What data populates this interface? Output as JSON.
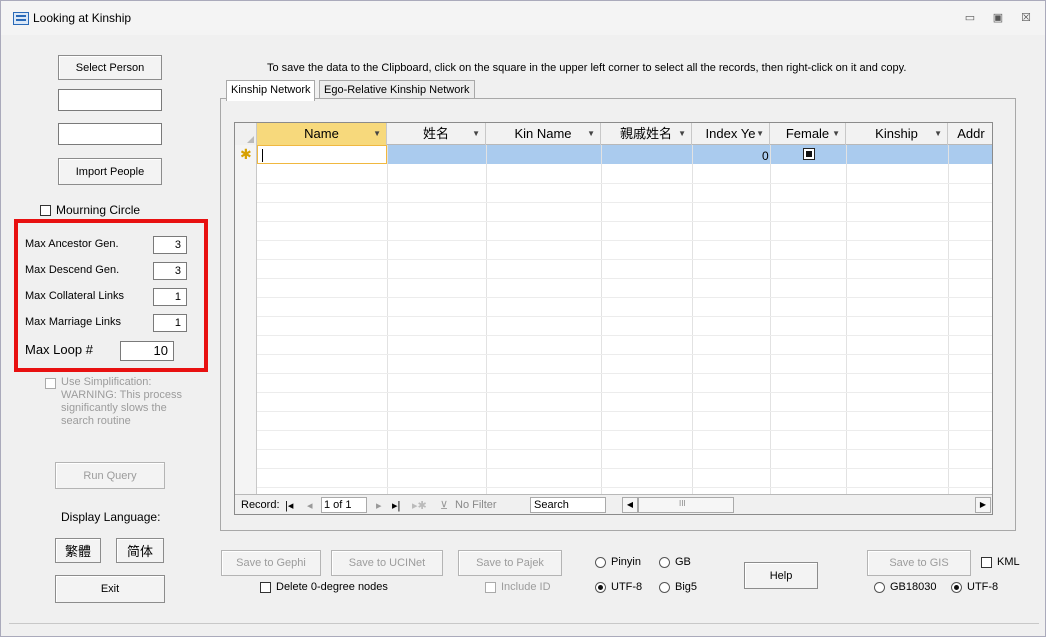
{
  "window": {
    "title": "Looking at Kinship",
    "minimize": "▭",
    "maximize": "▣",
    "close": "☒"
  },
  "left": {
    "select_person": "Select Person",
    "import_people": "Import People",
    "mourning_circle": "Mourning Circle",
    "params": [
      {
        "label": "Max Ancestor Gen.",
        "value": "3"
      },
      {
        "label": "Max Descend Gen.",
        "value": "3"
      },
      {
        "label": "Max Collateral Links",
        "value": "1"
      },
      {
        "label": "Max Marriage Links",
        "value": "1"
      }
    ],
    "max_loop_label": "Max Loop #",
    "max_loop_value": "10",
    "use_simplification": "Use Simplification:",
    "warning_line1": "WARNING: This process",
    "warning_line2": "significantly slows the",
    "warning_line3": "search routine",
    "run_query": "Run Query",
    "display_language": "Display Language:",
    "lang_traditional": "繁體",
    "lang_simplified": "简体",
    "exit": "Exit"
  },
  "main": {
    "instruction": "To save the data to the Clipboard, click on the square in the upper left corner to select all the records, then right-click on it and copy.",
    "tabs": [
      "Kinship Network",
      "Ego-Relative Kinship Network"
    ],
    "grid": {
      "columns": [
        "Name",
        "姓名",
        "Kin Name",
        "親戚姓名",
        "Index Ye",
        "Female",
        "Kinship",
        "Addr"
      ],
      "new_row_index_year": "0",
      "new_row_marker": "✱"
    },
    "nav": {
      "record_label": "Record:",
      "first": "|◂",
      "prev": "◂",
      "current": "1 of 1",
      "next": "▸",
      "last": "▸|",
      "new": "▸✱",
      "filter": "No Filter",
      "search": "Search",
      "scroll_left": "◀",
      "scroll_thumb": "III",
      "scroll_right": "▶"
    }
  },
  "bottom": {
    "save_gephi": "Save to Gephi",
    "save_ucinet": "Save to UCINet",
    "save_pajek": "Save to Pajek",
    "delete_zero": "Delete 0-degree nodes",
    "include_id": "Include ID",
    "pinyin": "Pinyin",
    "gb": "GB",
    "utf8": "UTF-8",
    "big5": "Big5",
    "help": "Help",
    "save_gis": "Save to GIS",
    "kml": "KML",
    "gb18030": "GB18030",
    "utf8_gis": "UTF-8"
  }
}
